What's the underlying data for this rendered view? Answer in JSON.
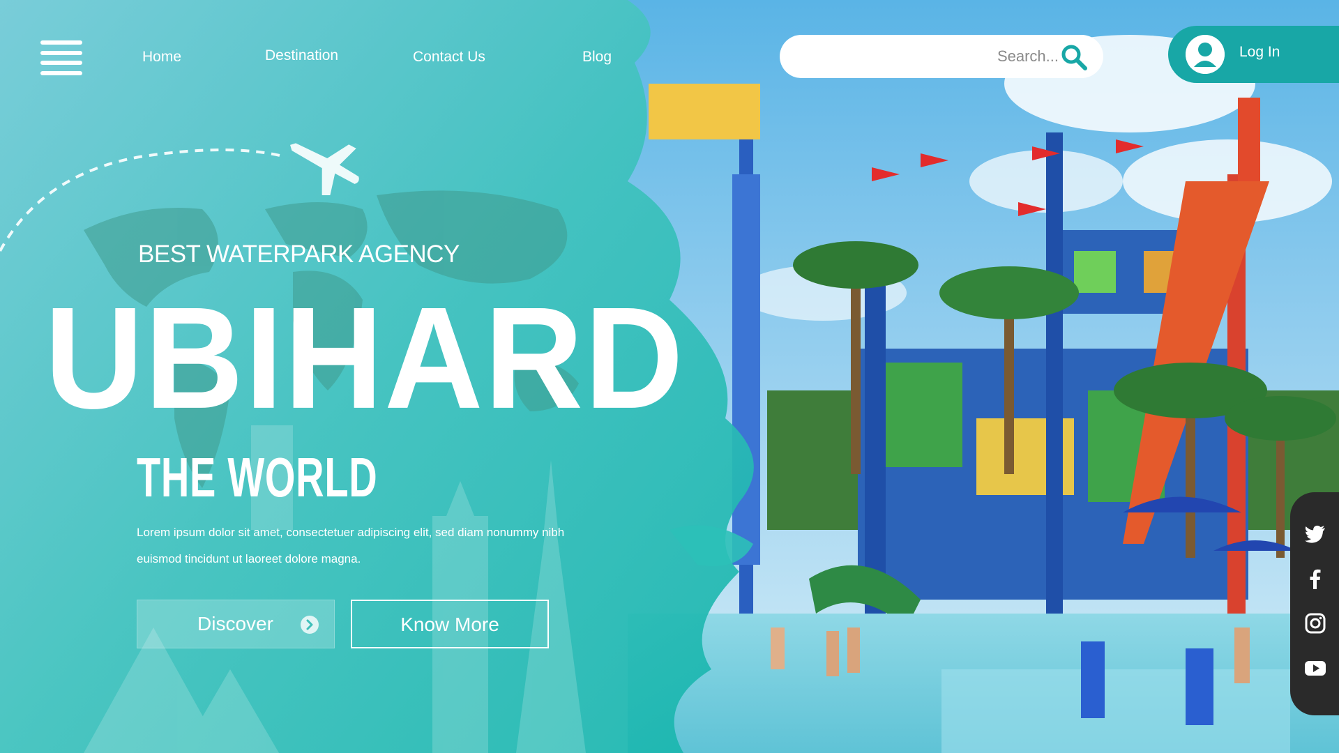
{
  "nav": {
    "menu_icon": "hamburger-menu-icon",
    "items": [
      {
        "label": "Home"
      },
      {
        "label": "Destination"
      },
      {
        "label": "Contact Us"
      },
      {
        "label": "Blog"
      }
    ]
  },
  "search": {
    "placeholder": "Search...",
    "icon": "search-icon"
  },
  "login": {
    "label": "Log In",
    "icon": "user-avatar-icon"
  },
  "hero": {
    "tagline": "BEST WATERPARK AGENCY",
    "brand": "UBIHARD",
    "subtitle": "THE WORLD",
    "description_line1": "Lorem ipsum dolor sit amet, consectetuer adipiscing elit, sed diam nonummy nibh",
    "description_line2": "euismod tincidunt ut laoreet dolore magna.",
    "discover_label": "Discover",
    "know_more_label": "Know More"
  },
  "social": [
    {
      "icon": "twitter-icon"
    },
    {
      "icon": "facebook-icon"
    },
    {
      "icon": "instagram-icon"
    },
    {
      "icon": "youtube-icon"
    }
  ],
  "colors": {
    "teal_overlay": "#2cc0b8",
    "login_bg": "#18a7a6",
    "search_icon": "#18a7a6",
    "social_bar": "#2a2a2a"
  }
}
